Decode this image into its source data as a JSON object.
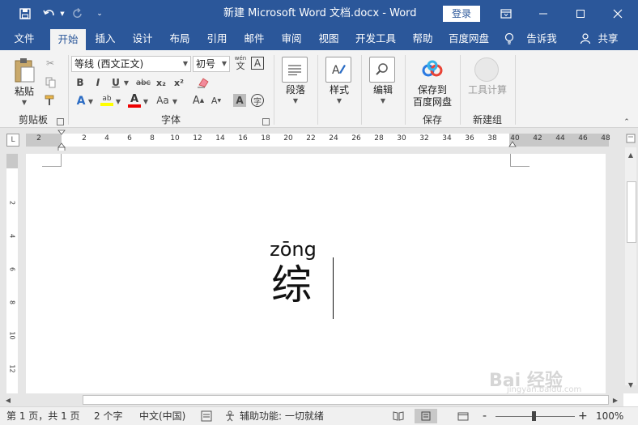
{
  "titlebar": {
    "title": "新建 Microsoft Word 文档.docx  -  Word",
    "login_label": "登录",
    "save_icon": "save-icon",
    "undo_icon": "undo-icon",
    "redo_icon": "redo-icon",
    "customize_icon": "customize-icon",
    "bg_color": "#2b579a"
  },
  "tabs": [
    {
      "label": "文件"
    },
    {
      "label": "开始"
    },
    {
      "label": "插入"
    },
    {
      "label": "设计"
    },
    {
      "label": "布局"
    },
    {
      "label": "引用"
    },
    {
      "label": "邮件"
    },
    {
      "label": "审阅"
    },
    {
      "label": "视图"
    },
    {
      "label": "开发工具"
    },
    {
      "label": "帮助"
    },
    {
      "label": "百度网盘"
    },
    {
      "label": "告诉我"
    },
    {
      "label": "共享"
    }
  ],
  "ribbon": {
    "clipboard": {
      "group_label": "剪贴板",
      "paste_label": "粘贴"
    },
    "font": {
      "group_label": "字体",
      "font_name": "等线 (西文正文)",
      "font_size": "初号",
      "bold": "B",
      "italic": "I",
      "underline": "U",
      "strike": "abc",
      "subscript": "x₂",
      "superscript": "x²",
      "phonetic": "wén",
      "phonetic_base": "文",
      "charbox": "A",
      "aa": "Aa",
      "grow": "A",
      "shrink": "A",
      "shade": "A",
      "enclose": "字"
    },
    "paragraph": {
      "label": "段落"
    },
    "styles": {
      "label": "样式"
    },
    "editing": {
      "label": "编辑"
    },
    "baidu": {
      "label_line1": "保存到",
      "label_line2": "百度网盘",
      "group_label": "保存"
    },
    "newgroup": {
      "label": "工具计算",
      "group_label": "新建组"
    }
  },
  "ruler": {
    "numbers": [
      "2",
      "2",
      "4",
      "6",
      "8",
      "10",
      "12",
      "14",
      "16",
      "18",
      "20",
      "22",
      "24",
      "26",
      "28",
      "30",
      "32",
      "34",
      "36",
      "38",
      "40",
      "42",
      "44",
      "46",
      "48"
    ],
    "corner": "L"
  },
  "vruler": {
    "numbers": [
      "2",
      "4",
      "6",
      "8",
      "10",
      "12"
    ]
  },
  "document": {
    "pinyin": "zōng",
    "hanzi": "综"
  },
  "statusbar": {
    "page": "第 1 页，共 1 页",
    "words": "2 个字",
    "language": "中文(中国)",
    "accessibility": "辅助功能: 一切就绪",
    "zoom_minus": "-",
    "zoom_plus": "+",
    "zoom": "100%"
  },
  "watermark": {
    "text": "Bai 经验",
    "sub": "jingyan.baidu.com"
  }
}
